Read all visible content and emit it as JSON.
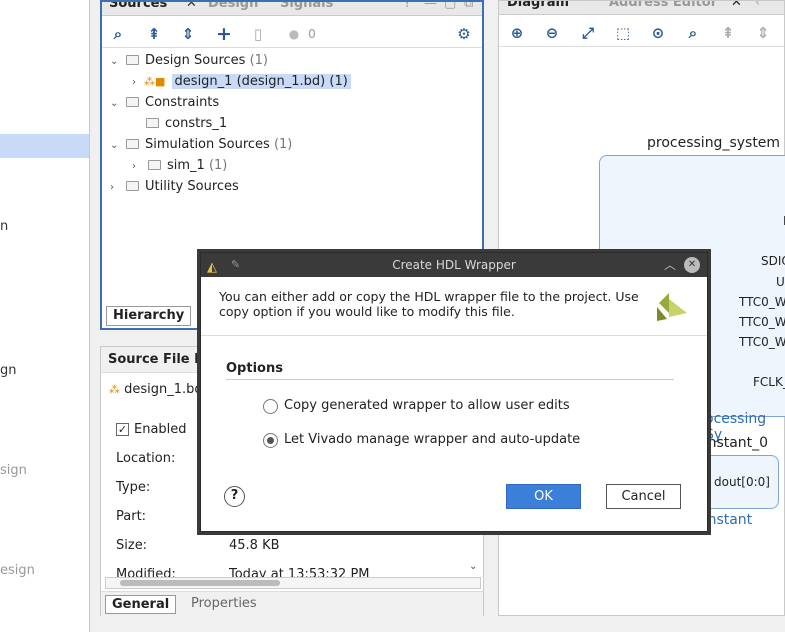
{
  "leftnav": {
    "frag1": "n",
    "frag2": "gn",
    "frag3": "sign",
    "frag4": "esign"
  },
  "sources": {
    "tabs": [
      "Sources",
      "Design",
      "Signals"
    ],
    "badge_count": "0",
    "tree": [
      {
        "label": "Design Sources",
        "count": "(1)"
      },
      {
        "label": "design_1 (design_1.bd) (1)"
      },
      {
        "label": "Constraints"
      },
      {
        "label": "constrs_1"
      },
      {
        "label": "Simulation Sources",
        "count": "(1)"
      },
      {
        "label": "sim_1",
        "count": "(1)"
      },
      {
        "label": "Utility Sources"
      }
    ],
    "hierarchy_tab": "Hierarchy"
  },
  "sfp": {
    "title": "Source File P",
    "file": "design_1.bd",
    "enabled_label": "Enabled",
    "labels": [
      "Location:",
      "Type:",
      "Part:",
      "Size:",
      "Modified:"
    ],
    "size_value": "45.8 KB",
    "modified_value": "Today at 13:53:32 PM",
    "tabs": [
      "General",
      "Properties"
    ]
  },
  "diagram": {
    "tabs": [
      "Diagram",
      "Address Editor"
    ],
    "block_title": "processing_system",
    "ports": [
      "F",
      "SDIO",
      "U",
      "TTC0_W",
      "TTC0_W",
      "TTC0_W",
      "FCLK_"
    ],
    "block_label": "ocessing Sy",
    "const_title": "onstant_0",
    "const_port": "dout[0:0]",
    "const_label": "onstant"
  },
  "dialog": {
    "title": "Create HDL Wrapper",
    "description": "You can either add or copy the HDL wrapper file to the project. Use copy option if you would like to modify this file.",
    "options_heading": "Options",
    "option1": "Copy generated wrapper to allow user edits",
    "option2": "Let Vivado manage wrapper and auto-update",
    "selected": "option2",
    "ok_label": "OK",
    "cancel_label": "Cancel",
    "help": "?"
  }
}
